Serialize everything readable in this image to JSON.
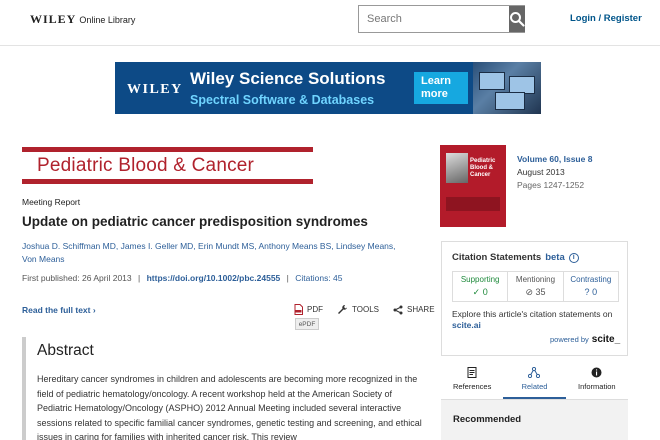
{
  "header": {
    "logo_brand": "WILEY",
    "logo_sub": "Online Library",
    "search_placeholder": "Search",
    "login_label": "Login / Register"
  },
  "banner": {
    "brand": "WILEY",
    "title": "Wiley Science Solutions",
    "subtitle": "Spectral Software & Databases",
    "button_line1": "Learn",
    "button_line2": "more"
  },
  "journal": {
    "title": "Pediatric Blood & Cancer",
    "cover_title": "Pediatric Blood & Cancer",
    "volume_issue": "Volume 60, Issue 8",
    "date": "August 2013",
    "pages": "Pages 1247-1252"
  },
  "article": {
    "type": "Meeting Report",
    "title": "Update on pediatric cancer predisposition syndromes",
    "authors_line1": "Joshua D. Schiffman MD, James I. Geller MD, Erin Mundt MS, Anthony Means BS, Lindsey Means,",
    "authors_line2": "Von Means",
    "first_published_label": "First published: 26 April 2013",
    "separator": "|",
    "doi": "https://doi.org/10.1002/pbc.24555",
    "citations_label": "Citations: 45",
    "read_full": "Read the full text ›",
    "tool_pdf": "PDF",
    "tool_tools": "TOOLS",
    "tool_share": "SHARE",
    "epdf_tooltip": "ePDF"
  },
  "abstract": {
    "heading": "Abstract",
    "text": "Hereditary cancer syndromes in children and adolescents are becoming more recognized in the field of pediatric hematology/oncology. A recent workshop held at the American Society of Pediatric Hematology/Oncology (ASPHO) 2012 Annual Meeting included several interactive sessions related to specific familial cancer syndromes, genetic testing and screening, and ethical issues in caring for families with inherited cancer risk. This review"
  },
  "citation_statements": {
    "heading": "Citation Statements",
    "beta": "beta",
    "supporting_label": "Supporting",
    "supporting_value": "0",
    "mentioning_label": "Mentioning",
    "mentioning_value": "35",
    "contrasting_label": "Contrasting",
    "contrasting_value": "0",
    "explore_text": "Explore this article's citation statements on",
    "explore_link": "scite.ai",
    "powered_by": "powered by",
    "scite_logo": "scite_"
  },
  "tabs": [
    {
      "label": "References"
    },
    {
      "label": "Related"
    },
    {
      "label": "Information"
    }
  ],
  "recommended": {
    "heading": "Recommended"
  },
  "colors": {
    "journal_red": "#b0222d",
    "link_blue": "#2d5f99",
    "banner_blue": "#0d4a86",
    "supporting_green": "#1f8a3c"
  }
}
